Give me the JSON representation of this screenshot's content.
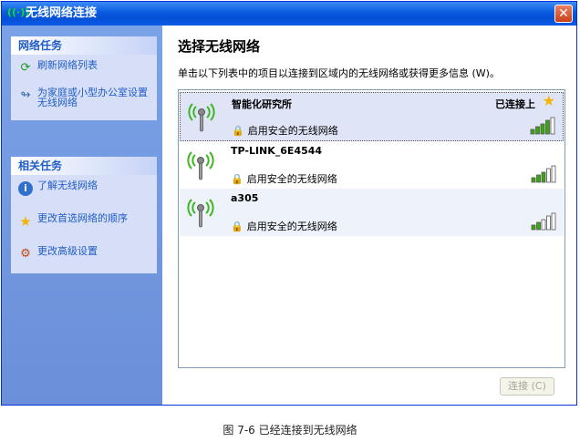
{
  "window": {
    "title": "无线网络连接",
    "title_icon": "((·))"
  },
  "sidebar": {
    "network_tasks": {
      "title": "网络任务",
      "items": [
        {
          "label": "刷新网络列表",
          "icon": "refresh-icon"
        },
        {
          "label": "为家庭或小型办公室设置无线网络",
          "icon": "setup-wizard-icon"
        }
      ]
    },
    "related_tasks": {
      "title": "相关任务",
      "items": [
        {
          "label": "了解无线网络",
          "icon": "info-icon"
        },
        {
          "label": "更改首选网络的顺序",
          "icon": "star-icon"
        },
        {
          "label": "更改高级设置",
          "icon": "settings-icon"
        }
      ]
    }
  },
  "main": {
    "heading": "选择无线网络",
    "instructions": "单击以下列表中的项目以连接到区域内的无线网络或获得更多信息 (W)。",
    "networks": [
      {
        "ssid": "智能化研究所",
        "status": "已连接上",
        "security": "启用安全的无线网络",
        "signal_bars": 4,
        "preferred": true
      },
      {
        "ssid": "TP-LINK_6E4544",
        "status": "",
        "security": "启用安全的无线网络",
        "signal_bars": 3,
        "preferred": false
      },
      {
        "ssid": "a305",
        "status": "",
        "security": "启用安全的无线网络",
        "signal_bars": 2,
        "preferred": false
      }
    ],
    "connect_button": "连接 (C)"
  },
  "caption": "图 7-6  已经连接到无线网络",
  "colors": {
    "titlebar": "#0a5ae0",
    "task_link": "#215dc6",
    "signal_active": "#39a80a",
    "signal_inactive": "#ffffff"
  }
}
